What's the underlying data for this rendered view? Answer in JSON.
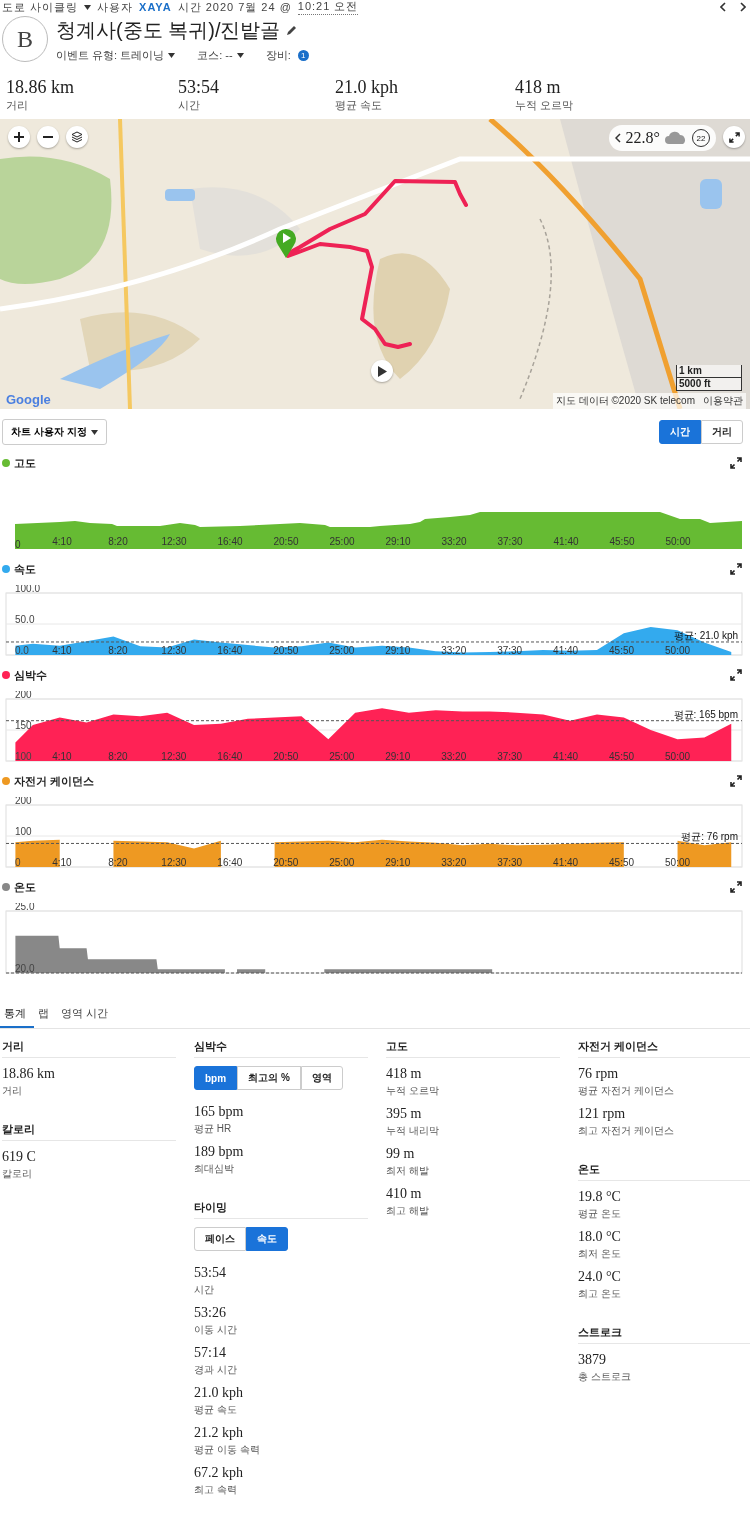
{
  "header": {
    "activity_type": "도로 사이클링",
    "user_label": "사용자",
    "user": "XAYA",
    "time_label": "시간 2020 7월 24 @",
    "time": "10:21 오전"
  },
  "avatar": "B",
  "title": "청계사(중도 복귀)/진밭골",
  "meta": [
    {
      "kind": "dropdown",
      "label": "이벤트 유형: 트레이닝"
    },
    {
      "kind": "dropdown",
      "label": "코스: --"
    },
    {
      "kind": "badge",
      "label": "장비:",
      "badge": "1"
    }
  ],
  "summary": [
    {
      "value": "18.86 km",
      "label": "거리"
    },
    {
      "value": "53:54",
      "label": "시간"
    },
    {
      "value": "21.0 kph",
      "label": "평균 속도"
    },
    {
      "value": "418 m",
      "label": "누적 오르막"
    }
  ],
  "map": {
    "temperature": "22.8°",
    "wind": "22",
    "scale": [
      "1 km",
      "5000 ft"
    ],
    "logo": "Google",
    "attribution": "지도 데이터 ©2020 SK telecom",
    "terms": "이용약관"
  },
  "chart_controls": {
    "customize": "차트 사용자 지정",
    "axis_toggle": [
      {
        "label": "시간",
        "selected": true
      },
      {
        "label": "거리",
        "selected": false
      }
    ]
  },
  "charts": [
    {
      "kind": "picture",
      "title": "고도",
      "color": "#66bb33",
      "x_labels": [
        "4:10",
        "8:20",
        "12:30",
        "16:40",
        "20:50",
        "25:00",
        "29:10",
        "33:20",
        "37:30",
        "41:40",
        "45:50",
        "50:00"
      ],
      "y_labels": [
        "0"
      ]
    },
    {
      "kind": "chart",
      "chart_data": {
        "type": "area",
        "x": [
          0.7,
          2,
          4,
          6,
          8,
          10,
          12,
          14,
          16,
          18,
          20,
          22,
          24,
          26,
          28,
          30,
          32,
          34,
          36,
          38,
          40,
          42,
          44,
          46,
          48,
          50,
          52,
          54
        ],
        "series": [
          {
            "name": "속도",
            "color": "#33aaee",
            "values": [
              15,
              18,
              15,
              22,
              30,
              14,
              12,
              25,
              20,
              16,
              12,
              14,
              20,
              12,
              15,
              12,
              6,
              4,
              5,
              6,
              8,
              7,
              8,
              35,
              45,
              40,
              20,
              5
            ]
          }
        ],
        "xlim": [
          0,
          54.8
        ],
        "ylim": [
          0,
          100
        ],
        "yticks": [
          {
            "value": 0,
            "label": "0.0"
          },
          {
            "value": 50,
            "label": "50.0"
          },
          {
            "value": 100,
            "label": "100.0"
          }
        ],
        "xticks": [
          {
            "value": 4.1667,
            "label": "4:10"
          },
          {
            "value": 8.3333,
            "label": "8:20"
          },
          {
            "value": 12.5,
            "label": "12:30"
          },
          {
            "value": 16.6667,
            "label": "16:40"
          },
          {
            "value": 20.8333,
            "label": "20:50"
          },
          {
            "value": 25,
            "label": "25:00"
          },
          {
            "value": 29.1667,
            "label": "29:10"
          },
          {
            "value": 33.3333,
            "label": "33:20"
          },
          {
            "value": 37.5,
            "label": "37:30"
          },
          {
            "value": 41.6667,
            "label": "41:40"
          },
          {
            "value": 45.8333,
            "label": "45:50"
          },
          {
            "value": 50,
            "label": "50:00"
          }
        ],
        "ref_lines": [
          {
            "axis": "y",
            "value": 21.0,
            "label": "평균: 21.0 kph"
          }
        ]
      }
    },
    {
      "kind": "chart",
      "chart_data": {
        "type": "area",
        "x": [
          0.7,
          2,
          4,
          6,
          8,
          10,
          12,
          14,
          16,
          18,
          20,
          22,
          24,
          26,
          28,
          30,
          32,
          34,
          36,
          38,
          40,
          42,
          44,
          46,
          48,
          50,
          52,
          54
        ],
        "series": [
          {
            "name": "심박수",
            "color": "#ff2255",
            "values": [
              130,
              158,
              170,
              162,
              175,
              172,
              178,
              158,
              160,
              168,
              170,
              172,
              135,
              178,
              185,
              178,
              182,
              180,
              180,
              178,
              175,
              165,
              175,
              170,
              150,
              135,
              138,
              160
            ]
          }
        ],
        "xlim": [
          0,
          54.8
        ],
        "ylim": [
          100,
          200
        ],
        "yticks": [
          {
            "value": 100,
            "label": "100"
          },
          {
            "value": 150,
            "label": "150"
          },
          {
            "value": 200,
            "label": "200"
          }
        ],
        "xticks": [
          {
            "value": 4.1667,
            "label": "4:10"
          },
          {
            "value": 8.3333,
            "label": "8:20"
          },
          {
            "value": 12.5,
            "label": "12:30"
          },
          {
            "value": 16.6667,
            "label": "16:40"
          },
          {
            "value": 20.8333,
            "label": "20:50"
          },
          {
            "value": 25,
            "label": "25:00"
          },
          {
            "value": 29.1667,
            "label": "29:10"
          },
          {
            "value": 33.3333,
            "label": "33:20"
          },
          {
            "value": 37.5,
            "label": "37:30"
          },
          {
            "value": 41.6667,
            "label": "41:40"
          },
          {
            "value": 45.8333,
            "label": "45:50"
          },
          {
            "value": 50,
            "label": "50:00"
          }
        ],
        "ref_lines": [
          {
            "axis": "y",
            "value": 165,
            "label": "평균: 165 bpm"
          }
        ]
      }
    },
    {
      "kind": "chart",
      "chart_data": {
        "type": "area",
        "x": [
          0.7,
          2,
          4,
          6,
          8,
          10,
          12,
          14,
          16,
          18,
          20,
          22,
          24,
          26,
          28,
          30,
          32,
          34,
          36,
          38,
          40,
          42,
          44,
          46,
          48,
          50,
          52,
          54
        ],
        "series": [
          {
            "name": "자전거 케이던스",
            "color": "#ee9922",
            "values": [
              80,
              85,
              88,
              null,
              85,
              82,
              80,
              60,
              85,
              null,
              80,
              82,
              85,
              80,
              88,
              82,
              78,
              70,
              75,
              70,
              72,
              75,
              78,
              80,
              null,
              85,
              70,
              80
            ]
          }
        ],
        "xlim": [
          0,
          54.8
        ],
        "ylim": [
          0,
          200
        ],
        "yticks": [
          {
            "value": 0,
            "label": "0"
          },
          {
            "value": 100,
            "label": "100"
          },
          {
            "value": 200,
            "label": "200"
          }
        ],
        "xticks": [
          {
            "value": 4.1667,
            "label": "4:10"
          },
          {
            "value": 8.3333,
            "label": "8:20"
          },
          {
            "value": 12.5,
            "label": "12:30"
          },
          {
            "value": 16.6667,
            "label": "16:40"
          },
          {
            "value": 20.8333,
            "label": "20:50"
          },
          {
            "value": 25,
            "label": "25:00"
          },
          {
            "value": 29.1667,
            "label": "29:10"
          },
          {
            "value": 33.3333,
            "label": "33:20"
          },
          {
            "value": 37.5,
            "label": "37:30"
          },
          {
            "value": 41.6667,
            "label": "41:40"
          },
          {
            "value": 45.8333,
            "label": "45:50"
          },
          {
            "value": 50,
            "label": "50:00"
          }
        ],
        "ref_lines": [
          {
            "axis": "y",
            "value": 76,
            "label": "평균: 76 rpm"
          }
        ]
      }
    },
    {
      "kind": "chart",
      "chart_data": {
        "type": "area",
        "x": [
          0.7,
          3.9,
          4,
          6,
          6.1,
          11.2,
          11.3,
          16.3,
          16.4,
          17.2,
          19.3,
          19.4,
          23.7,
          36.2
        ],
        "series": [
          {
            "name": "온도",
            "color": "#888888",
            "values": [
              23.0,
              23.0,
              22.0,
              22.0,
              21.1,
              21.1,
              20.3,
              20.3,
              null,
              20.3,
              20.3,
              null,
              20.3,
              20.3
            ]
          }
        ],
        "xlim": [
          0,
          54.8
        ],
        "ylim": [
          20,
          25
        ],
        "yticks": [
          {
            "value": 20,
            "label": "20.0"
          },
          {
            "value": 25,
            "label": "25.0"
          }
        ],
        "ref_lines": [
          {
            "axis": "y",
            "value": 20
          }
        ]
      }
    }
  ],
  "tabs": [
    {
      "label": "통계",
      "selected": true
    },
    {
      "label": "랩",
      "selected": false
    },
    {
      "label": "영역 시간",
      "selected": false
    }
  ],
  "stats_columns": [
    [
      {
        "heading": "거리",
        "items": [
          {
            "value": "18.86 km",
            "label": "거리"
          }
        ]
      },
      {
        "heading": "칼로리",
        "items": [
          {
            "value": "619 C",
            "label": "칼로리"
          }
        ]
      }
    ],
    [
      {
        "heading": "심박수",
        "toggle": [
          {
            "label": "bpm",
            "selected": true
          },
          {
            "label": "최고의 %",
            "selected": false
          },
          {
            "label": "영역",
            "selected": false
          }
        ],
        "items": [
          {
            "value": "165 bpm",
            "label": "평균 HR"
          },
          {
            "value": "189 bpm",
            "label": "최대심박"
          }
        ]
      },
      {
        "heading": "타이밍",
        "toggle": [
          {
            "label": "페이스",
            "selected": false
          },
          {
            "label": "속도",
            "selected": true
          }
        ],
        "items": [
          {
            "value": "53:54",
            "label": "시간"
          },
          {
            "value": "53:26",
            "label": "이동 시간"
          },
          {
            "value": "57:14",
            "label": "경과 시간"
          },
          {
            "value": "21.0 kph",
            "label": "평균 속도"
          },
          {
            "value": "21.2 kph",
            "label": "평균 이동 속력"
          },
          {
            "value": "67.2 kph",
            "label": "최고 속력"
          }
        ]
      }
    ],
    [
      {
        "heading": "고도",
        "items": [
          {
            "value": "418 m",
            "label": "누적 오르막"
          },
          {
            "value": "395 m",
            "label": "누적 내리막"
          },
          {
            "value": "99 m",
            "label": "최저 해발"
          },
          {
            "value": "410 m",
            "label": "최고 해발"
          }
        ]
      }
    ],
    [
      {
        "heading": "자전거 케이던스",
        "items": [
          {
            "value": "76 rpm",
            "label": "평균 자전거 케이던스"
          },
          {
            "value": "121 rpm",
            "label": "최고 자전거 케이던스"
          }
        ]
      },
      {
        "heading": "온도",
        "items": [
          {
            "value": "19.8 °C",
            "label": "평균 온도"
          },
          {
            "value": "18.0 °C",
            "label": "최저 온도"
          },
          {
            "value": "24.0 °C",
            "label": "최고 온도"
          }
        ]
      },
      {
        "heading": "스트로크",
        "items": [
          {
            "value": "3879",
            "label": "총 스트로크"
          }
        ]
      }
    ]
  ]
}
